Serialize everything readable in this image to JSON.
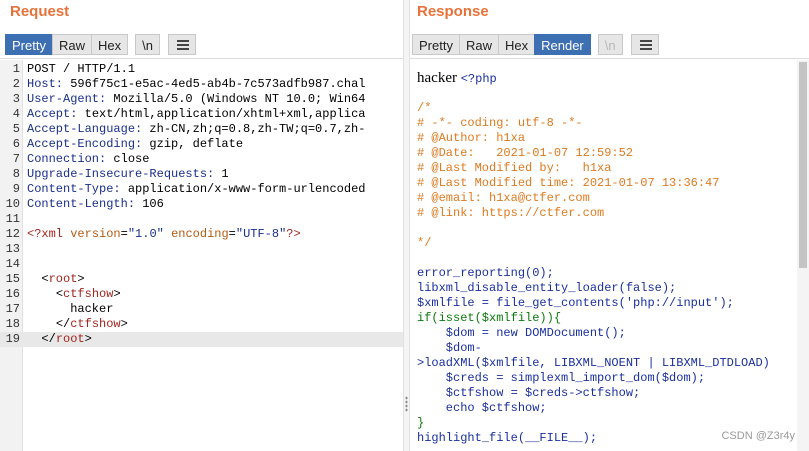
{
  "request": {
    "title": "Request",
    "tabs": [
      "Pretty",
      "Raw",
      "Hex",
      "\\n"
    ],
    "active_tab": "Pretty",
    "lines": [
      {
        "n": "1",
        "text": "POST / HTTP/1.1"
      },
      {
        "n": "2",
        "key": "Host:",
        "val": " 596f75c1-e5ac-4ed5-ab4b-7c573adfb987.chal"
      },
      {
        "n": "3",
        "key": "User-Agent:",
        "val": " Mozilla/5.0 (Windows NT 10.0; Win64"
      },
      {
        "n": "4",
        "key": "Accept:",
        "val": " text/html,application/xhtml+xml,applica"
      },
      {
        "n": "5",
        "key": "Accept-Language:",
        "val": " zh-CN,zh;q=0.8,zh-TW;q=0.7,zh-"
      },
      {
        "n": "6",
        "key": "Accept-Encoding:",
        "val": " gzip, deflate"
      },
      {
        "n": "7",
        "key": "Connection:",
        "val": " close"
      },
      {
        "n": "8",
        "key": "Upgrade-Insecure-Requests:",
        "val": " 1"
      },
      {
        "n": "9",
        "key": "Content-Type:",
        "val": " application/x-www-form-urlencoded"
      },
      {
        "n": "10",
        "key": "Content-Length:",
        "val": " 106"
      },
      {
        "n": "11",
        "text": ""
      },
      {
        "n": "12",
        "xmldecl": true
      },
      {
        "n": "13",
        "text": ""
      },
      {
        "n": "14",
        "text": ""
      },
      {
        "n": "15",
        "open": "root",
        "indent": "  "
      },
      {
        "n": "16",
        "open": "ctfshow",
        "indent": "    "
      },
      {
        "n": "17",
        "text": "      hacker"
      },
      {
        "n": "18",
        "close": "ctfshow",
        "indent": "    "
      },
      {
        "n": "19",
        "close": "root",
        "indent": "  "
      }
    ],
    "xml_decl": {
      "start": "<?xml ",
      "version_attr": "version",
      "version_val": "\"1.0\"",
      "enc_attr": "encoding",
      "enc_val": "\"UTF-8\"",
      "end": "?>"
    }
  },
  "response": {
    "title": "Response",
    "tabs": [
      "Pretty",
      "Raw",
      "Hex",
      "Render",
      "\\n"
    ],
    "active_tab": "Render",
    "hacker_text": "hacker",
    "php_open": "<?php",
    "lines": [
      {
        "t": "/*",
        "c": "orange"
      },
      {
        "t": "# -*- coding: utf-8 -*-",
        "c": "orange"
      },
      {
        "t": "# @Author: h1xa",
        "c": "orange"
      },
      {
        "t": "# @Date:   2021-01-07 12:59:52",
        "c": "orange"
      },
      {
        "t": "# @Last Modified by:   h1xa",
        "c": "orange"
      },
      {
        "t": "# @Last Modified time: 2021-01-07 13:36:47",
        "c": "orange"
      },
      {
        "t": "# @email: h1xa@ctfer.com",
        "c": "orange"
      },
      {
        "t": "# @link: https://ctfer.com",
        "c": "orange"
      },
      {
        "t": "",
        "c": "orange"
      },
      {
        "t": "*/",
        "c": "orange"
      },
      {
        "t": "",
        "c": "blue"
      },
      {
        "t": "error_reporting(0);",
        "c": "blue"
      },
      {
        "t": "libxml_disable_entity_loader(false);",
        "c": "blue"
      },
      {
        "t": "$xmlfile = file_get_contents('php://input');",
        "c": "blue"
      },
      {
        "t": "if(isset($xmlfile)){",
        "c": "green"
      },
      {
        "t": "    $dom = new DOMDocument();",
        "c": "blue"
      },
      {
        "t": "    $dom-",
        "c": "blue"
      },
      {
        "t": ">loadXML($xmlfile, LIBXML_NOENT | LIBXML_DTDLOAD)",
        "c": "blue"
      },
      {
        "t": "    $creds = simplexml_import_dom($dom);",
        "c": "blue"
      },
      {
        "t": "    $ctfshow = $creds->ctfshow;",
        "c": "blue"
      },
      {
        "t": "    echo $ctfshow;",
        "c": "blue"
      },
      {
        "t": "}",
        "c": "green"
      },
      {
        "t": "highlight_file(__FILE__);",
        "c": "blue"
      }
    ]
  },
  "watermark": "CSDN @Z3r4y",
  "colors": {
    "accent": "#3d6fb3",
    "title": "#e8733a"
  }
}
